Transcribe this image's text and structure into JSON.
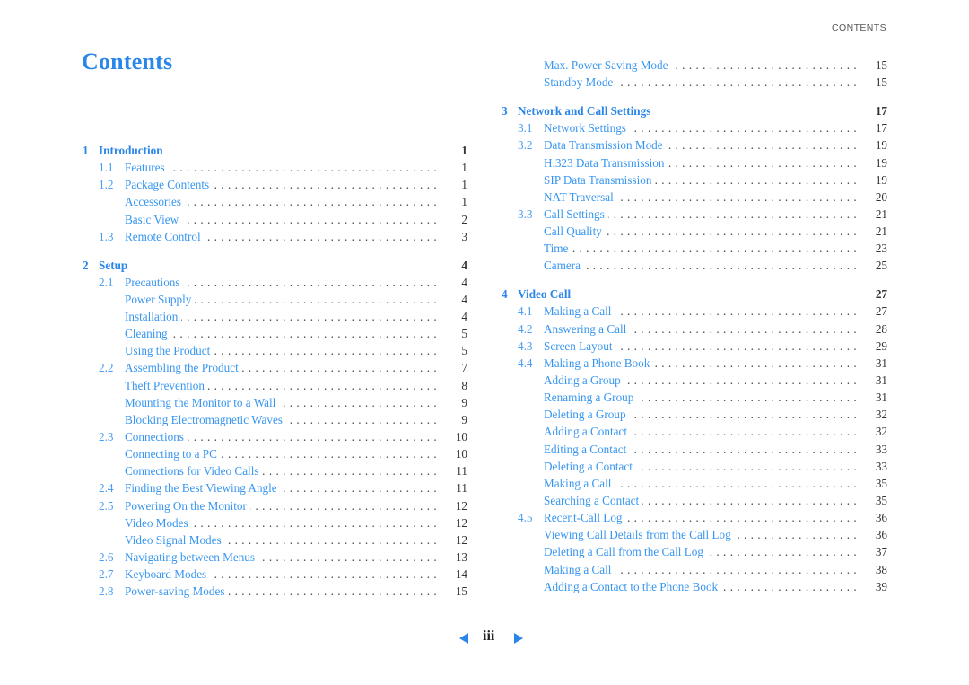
{
  "header": {
    "running_head": "CONTENTS",
    "title": "Contents"
  },
  "colors": {
    "accent": "#2a86e8",
    "link": "#3896f0",
    "text": "#333333"
  },
  "toc": {
    "left": [
      {
        "level": 0,
        "num": "1",
        "title": "Introduction",
        "page": "1",
        "gap": false
      },
      {
        "level": 1,
        "num": "1.1",
        "title": "Features",
        "page": "1"
      },
      {
        "level": 1,
        "num": "1.2",
        "title": "Package Contents",
        "page": "1"
      },
      {
        "level": 2,
        "num": "",
        "title": "Accessories",
        "page": "1"
      },
      {
        "level": 2,
        "num": "",
        "title": "Basic View",
        "page": "2"
      },
      {
        "level": 1,
        "num": "1.3",
        "title": "Remote Control",
        "page": "3"
      },
      {
        "level": 0,
        "num": "2",
        "title": "Setup",
        "page": "4",
        "gap": true
      },
      {
        "level": 1,
        "num": "2.1",
        "title": "Precautions",
        "page": "4"
      },
      {
        "level": 2,
        "num": "",
        "title": "Power Supply",
        "page": "4"
      },
      {
        "level": 2,
        "num": "",
        "title": "Installation",
        "page": "4"
      },
      {
        "level": 2,
        "num": "",
        "title": "Cleaning",
        "page": "5"
      },
      {
        "level": 2,
        "num": "",
        "title": "Using the Product",
        "page": "5"
      },
      {
        "level": 1,
        "num": "2.2",
        "title": "Assembling the Product",
        "page": "7"
      },
      {
        "level": 2,
        "num": "",
        "title": "Theft Prevention",
        "page": "8"
      },
      {
        "level": 2,
        "num": "",
        "title": "Mounting the Monitor to a Wall",
        "page": "9"
      },
      {
        "level": 2,
        "num": "",
        "title": "Blocking Electromagnetic Waves",
        "page": "9"
      },
      {
        "level": 1,
        "num": "2.3",
        "title": "Connections",
        "page": "10"
      },
      {
        "level": 2,
        "num": "",
        "title": "Connecting to a PC",
        "page": "10"
      },
      {
        "level": 2,
        "num": "",
        "title": "Connections for Video Calls",
        "page": "11"
      },
      {
        "level": 1,
        "num": "2.4",
        "title": "Finding the Best Viewing Angle",
        "page": "11"
      },
      {
        "level": 1,
        "num": "2.5",
        "title": "Powering On the Monitor",
        "page": "12"
      },
      {
        "level": 2,
        "num": "",
        "title": "Video Modes",
        "page": "12"
      },
      {
        "level": 2,
        "num": "",
        "title": "Video Signal Modes",
        "page": "12"
      },
      {
        "level": 1,
        "num": "2.6",
        "title": "Navigating between Menus",
        "page": "13"
      },
      {
        "level": 1,
        "num": "2.7",
        "title": "Keyboard Modes",
        "page": "14"
      },
      {
        "level": 1,
        "num": "2.8",
        "title": "Power-saving Modes",
        "page": "15"
      }
    ],
    "right": [
      {
        "level": 2,
        "num": "",
        "title": "Max. Power Saving Mode",
        "page": "15"
      },
      {
        "level": 2,
        "num": "",
        "title": "Standby Mode",
        "page": "15"
      },
      {
        "level": 0,
        "num": "3",
        "title": "Network and Call Settings",
        "page": "17",
        "gap": true
      },
      {
        "level": 1,
        "num": "3.1",
        "title": "Network Settings",
        "page": "17"
      },
      {
        "level": 1,
        "num": "3.2",
        "title": "Data Transmission Mode",
        "page": "19"
      },
      {
        "level": 2,
        "num": "",
        "title": "H.323 Data Transmission",
        "page": "19"
      },
      {
        "level": 2,
        "num": "",
        "title": "SIP Data Transmission",
        "page": "19"
      },
      {
        "level": 2,
        "num": "",
        "title": "NAT Traversal",
        "page": "20"
      },
      {
        "level": 1,
        "num": "3.3",
        "title": "Call Settings",
        "page": "21"
      },
      {
        "level": 2,
        "num": "",
        "title": "Call Quality",
        "page": "21"
      },
      {
        "level": 2,
        "num": "",
        "title": "Time",
        "page": "23"
      },
      {
        "level": 2,
        "num": "",
        "title": "Camera",
        "page": "25"
      },
      {
        "level": 0,
        "num": "4",
        "title": "Video Call",
        "page": "27",
        "gap": true
      },
      {
        "level": 1,
        "num": "4.1",
        "title": "Making a Call",
        "page": "27"
      },
      {
        "level": 1,
        "num": "4.2",
        "title": "Answering a Call",
        "page": "28"
      },
      {
        "level": 1,
        "num": "4.3",
        "title": "Screen Layout",
        "page": "29"
      },
      {
        "level": 1,
        "num": "4.4",
        "title": "Making a Phone Book",
        "page": "31"
      },
      {
        "level": 2,
        "num": "",
        "title": "Adding a Group",
        "page": "31"
      },
      {
        "level": 2,
        "num": "",
        "title": "Renaming a Group",
        "page": "31"
      },
      {
        "level": 2,
        "num": "",
        "title": "Deleting a Group",
        "page": "32"
      },
      {
        "level": 2,
        "num": "",
        "title": "Adding a Contact",
        "page": "32"
      },
      {
        "level": 2,
        "num": "",
        "title": "Editing a Contact",
        "page": "33"
      },
      {
        "level": 2,
        "num": "",
        "title": "Deleting a Contact",
        "page": "33"
      },
      {
        "level": 2,
        "num": "",
        "title": "Making a Call",
        "page": "35"
      },
      {
        "level": 2,
        "num": "",
        "title": "Searching a Contact",
        "page": "35"
      },
      {
        "level": 1,
        "num": "4.5",
        "title": "Recent-Call Log",
        "page": "36"
      },
      {
        "level": 2,
        "num": "",
        "title": "Viewing Call Details from the Call Log",
        "page": "36"
      },
      {
        "level": 2,
        "num": "",
        "title": "Deleting a Call from the Call Log",
        "page": "37"
      },
      {
        "level": 2,
        "num": "",
        "title": "Making a Call",
        "page": "38"
      },
      {
        "level": 2,
        "num": "",
        "title": "Adding a Contact to the Phone Book",
        "page": "39"
      }
    ]
  },
  "pager": {
    "page_label": "iii",
    "prev_icon": "triangle-left-icon",
    "next_icon": "triangle-right-icon"
  }
}
